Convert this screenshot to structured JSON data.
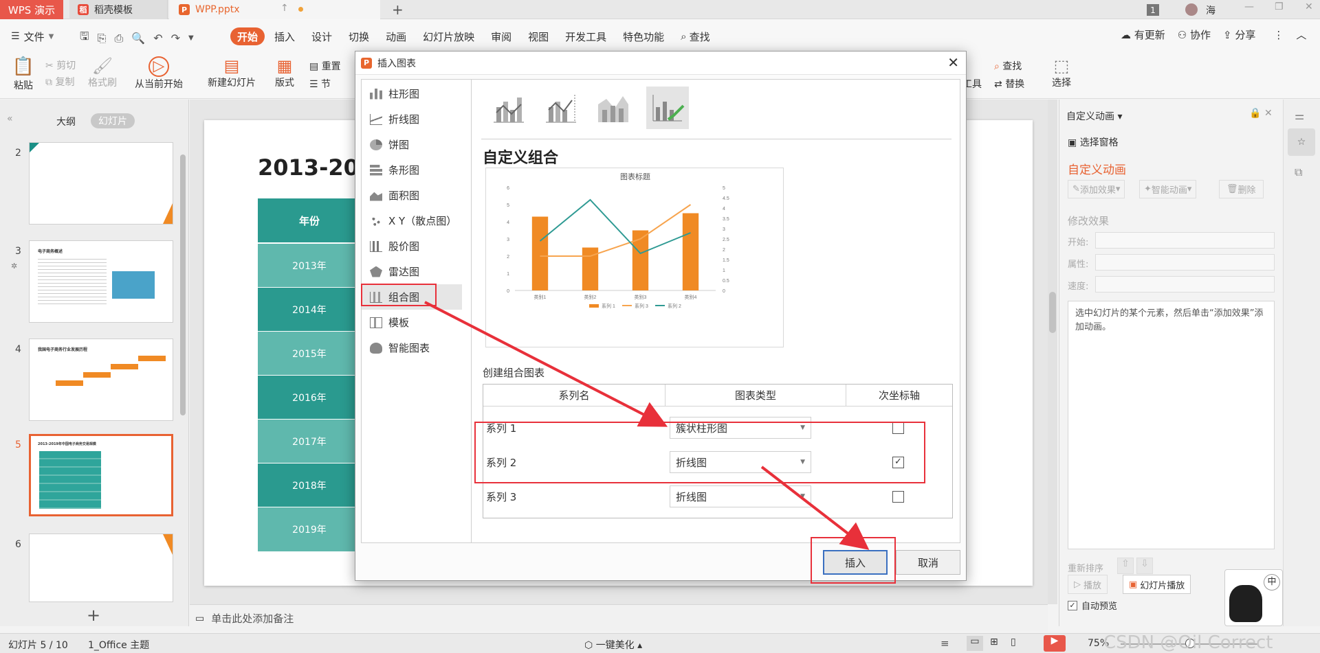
{
  "tabbar": {
    "brand": "WPS 演示",
    "tabs": [
      {
        "label": "稻壳模板"
      },
      {
        "label": "WPP.pptx"
      }
    ],
    "new_tab": "+",
    "page_badge": "1",
    "user_name": "海"
  },
  "menubar": {
    "file": "文件",
    "items": [
      "开始",
      "插入",
      "设计",
      "切换",
      "动画",
      "幻灯片放映",
      "审阅",
      "视图",
      "开发工具",
      "特色功能"
    ],
    "search": "查找",
    "right": [
      "有更新",
      "协作",
      "分享"
    ]
  },
  "ribbon": {
    "paste": "粘贴",
    "cut": "剪切",
    "copy": "复制",
    "format_painter": "格式刷",
    "from_current": "从当前开始",
    "new_slide": "新建幻灯片",
    "layout": "版式",
    "reset": "重置",
    "section": "节",
    "tools": "工具",
    "find": "查找",
    "replace": "替换",
    "select": "选择"
  },
  "leftpanel": {
    "tabs": [
      "大纲",
      "幻灯片"
    ],
    "slides": [
      {
        "num": "2",
        "title": ""
      },
      {
        "num": "3",
        "title": "电子商务概述"
      },
      {
        "num": "4",
        "title": "我国电子商务行业发展历程"
      },
      {
        "num": "5",
        "title": "2013-2019年中国电子商务交易规模"
      },
      {
        "num": "6",
        "title": ""
      }
    ],
    "add": "+"
  },
  "slide": {
    "title": "2013-20",
    "header": "年份",
    "years": [
      "2013年",
      "2014年",
      "2015年",
      "2016年",
      "2017年",
      "2018年",
      "2019年"
    ]
  },
  "notes": {
    "placeholder": "单击此处添加备注"
  },
  "dialog": {
    "title": "插入图表",
    "chart_types": [
      "柱形图",
      "折线图",
      "饼图",
      "条形图",
      "面积图",
      "X Y（散点图）",
      "股价图",
      "雷达图",
      "组合图",
      "模板",
      "智能图表"
    ],
    "section_title": "自定义组合",
    "section_label": "创建组合图表",
    "table_headers": [
      "系列名",
      "图表类型",
      "次坐标轴"
    ],
    "series_rows": [
      {
        "name": "系列 1",
        "type": "簇状柱形图",
        "secondary": false
      },
      {
        "name": "系列 2",
        "type": "折线图",
        "secondary": true
      },
      {
        "name": "系列 3",
        "type": "折线图",
        "secondary": false
      }
    ],
    "insert": "插入",
    "cancel": "取消",
    "accent_red": "#e8303a"
  },
  "chart_data": {
    "type": "bar",
    "title": "图表标题",
    "categories": [
      "类别1",
      "类别2",
      "类别3",
      "类别4"
    ],
    "y_ticks_left": [
      "0",
      "1",
      "2",
      "3",
      "4",
      "5",
      "6"
    ],
    "y_ticks_right": [
      "0",
      "0.5",
      "1",
      "1.5",
      "2",
      "2.5",
      "3",
      "3.5",
      "4",
      "4.5",
      "5"
    ],
    "ylim_left": [
      0,
      6
    ],
    "ylim_right": [
      0,
      5
    ],
    "series": [
      {
        "name": "系列 1",
        "type": "bar",
        "axis": "left",
        "values": [
          4.3,
          2.5,
          3.5,
          4.5
        ],
        "color": "#f08a24"
      },
      {
        "name": "系列 3",
        "type": "line",
        "axis": "left",
        "values": [
          2,
          2,
          3,
          5
        ],
        "color": "#f7a44e"
      },
      {
        "name": "系列 2",
        "type": "line",
        "axis": "right",
        "values": [
          2.4,
          4.4,
          1.8,
          2.8
        ],
        "color": "#2e9a93"
      }
    ],
    "legend": "bottom"
  },
  "rightpanel": {
    "title": "自定义动画",
    "select_pane": "选择窗格",
    "section": "自定义动画",
    "add_effect": "添加效果",
    "smart_anim": "智能动画",
    "delete": "删除",
    "modify": "修改效果",
    "start_label": "开始:",
    "prop_label": "属性:",
    "speed_label": "速度:",
    "hint": "选中幻灯片的某个元素，然后单击“添加效果”添加动画。",
    "reorder": "重新排序",
    "play": "播放",
    "slideshow": "幻灯片播放",
    "autopreview": "自动预览",
    "ime": "中"
  },
  "statusbar": {
    "slide_info": "幻灯片 5 / 10",
    "theme": "1_Office 主题",
    "beautify": "一键美化",
    "zoom": "75%",
    "watermark": "CSDN @Oil Correct"
  }
}
